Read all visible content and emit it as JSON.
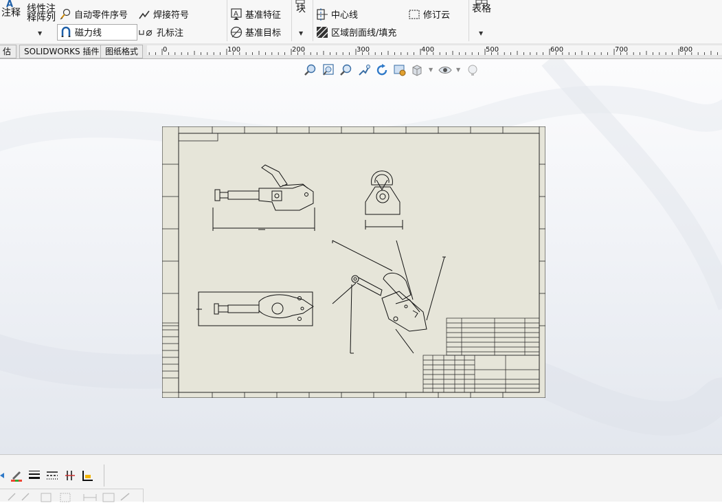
{
  "ribbon": {
    "annotation": "注释",
    "linear_pattern_top": "线性注",
    "linear_pattern_bottom": "释阵列",
    "auto_balloon": "自动零件序号",
    "weld_symbol": "焊接符号",
    "magnetic_line": "磁力线",
    "hole_callout": "孔标注",
    "datum_feature": "基准特征",
    "datum_target": "基准目标",
    "block": "块",
    "centerline": "中心线",
    "revision_cloud": "修订云",
    "area_hatch": "区域剖面线/填充",
    "tables": "表格"
  },
  "tabs": [
    {
      "label": "估"
    },
    {
      "label": "SOLIDWORKS 插件"
    },
    {
      "label": "图纸格式"
    }
  ],
  "ruler": {
    "labels": [
      "0",
      "100",
      "200",
      "300",
      "400",
      "500",
      "600",
      "700",
      "800"
    ]
  },
  "colors": {
    "sheet": "#e6e5d9",
    "accent": "#1d5fa8",
    "ribbon": "#f7f7f7"
  }
}
